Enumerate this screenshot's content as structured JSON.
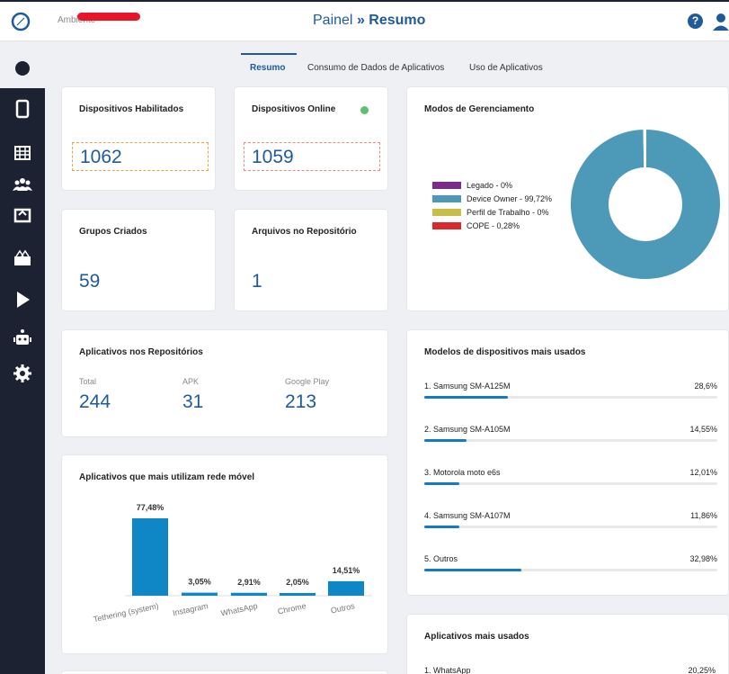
{
  "header": {
    "ambiente_label": "Ambiente",
    "title_prefix": "Painel",
    "title_sep": "»",
    "title_main": "Resumo",
    "help_label": "?"
  },
  "tabs": [
    {
      "label": "Resumo",
      "active": true
    },
    {
      "label": "Consumo de Dados de Aplicativos",
      "active": false
    },
    {
      "label": "Uso de Aplicativos",
      "active": false
    }
  ],
  "sidebar": {
    "items": [
      {
        "icon": "phone-icon"
      },
      {
        "icon": "grid-icon"
      },
      {
        "icon": "groups-icon"
      },
      {
        "icon": "inbox-icon"
      },
      {
        "icon": "devices-icon"
      },
      {
        "icon": "play-store-icon"
      },
      {
        "icon": "robot-icon"
      },
      {
        "icon": "gear-icon"
      }
    ]
  },
  "cards": {
    "habilitados": {
      "title": "Dispositivos Habilitados",
      "value": "1062"
    },
    "online": {
      "title": "Dispositivos Online",
      "value": "1059"
    },
    "grupos": {
      "title": "Grupos Criados",
      "value": "59"
    },
    "arquivos": {
      "title": "Arquivos no Repositório",
      "value": "1"
    },
    "repos": {
      "title": "Aplicativos nos Repositórios",
      "total_label": "Total",
      "total_value": "244",
      "apk_label": "APK",
      "apk_value": "31",
      "gplay_label": "Google Play",
      "gplay_value": "213"
    },
    "gerenciamento": {
      "title": "Modos de Gerenciamento",
      "legend": [
        {
          "label": "Legado - 0%",
          "color": "#7b2b88"
        },
        {
          "label": "Device Owner - 99,72%",
          "color": "#4c9ab8"
        },
        {
          "label": "Perfil de Trabalho - 0%",
          "color": "#c8bd46"
        },
        {
          "label": "COPE - 0,28%",
          "color": "#d9292b"
        }
      ]
    },
    "modelos": {
      "title": "Modelos de dispositivos mais usados",
      "rows": [
        {
          "name": "1. Samsung SM-A125M",
          "pct": "28,6%",
          "fill": 28.6
        },
        {
          "name": "2. Samsung SM-A105M",
          "pct": "14,55%",
          "fill": 14.55
        },
        {
          "name": "3. Motorola moto e6s",
          "pct": "12,01%",
          "fill": 12.01
        },
        {
          "name": "4. Samsung SM-A107M",
          "pct": "11,86%",
          "fill": 11.86
        },
        {
          "name": "5. Outros",
          "pct": "32,98%",
          "fill": 32.98
        }
      ]
    },
    "rede_movel": {
      "title": "Aplicativos que mais utilizam rede móvel"
    },
    "mais_usados": {
      "title": "Aplicativos mais usados",
      "rows": [
        {
          "name": "1. WhatsApp",
          "pct": "20,25%"
        }
      ]
    }
  },
  "chart_data": [
    {
      "type": "pie",
      "labels": [
        "Legado",
        "Device Owner",
        "Perfil de Trabalho",
        "COPE"
      ],
      "values": [
        0,
        99.72,
        0,
        0.28
      ],
      "colors": [
        "#7b2b88",
        "#4c9ab8",
        "#c8bd46",
        "#d9292b"
      ]
    },
    {
      "type": "bar",
      "categories": [
        "Tethering (system)",
        "Instagram",
        "WhatsApp",
        "Chrome",
        "Outros"
      ],
      "values": [
        77.48,
        3.05,
        2.91,
        2.05,
        14.51
      ],
      "value_labels": [
        "77,48%",
        "3,05%",
        "2,91%",
        "2,05%",
        "14,51%"
      ],
      "color": "#0f86c6"
    }
  ]
}
